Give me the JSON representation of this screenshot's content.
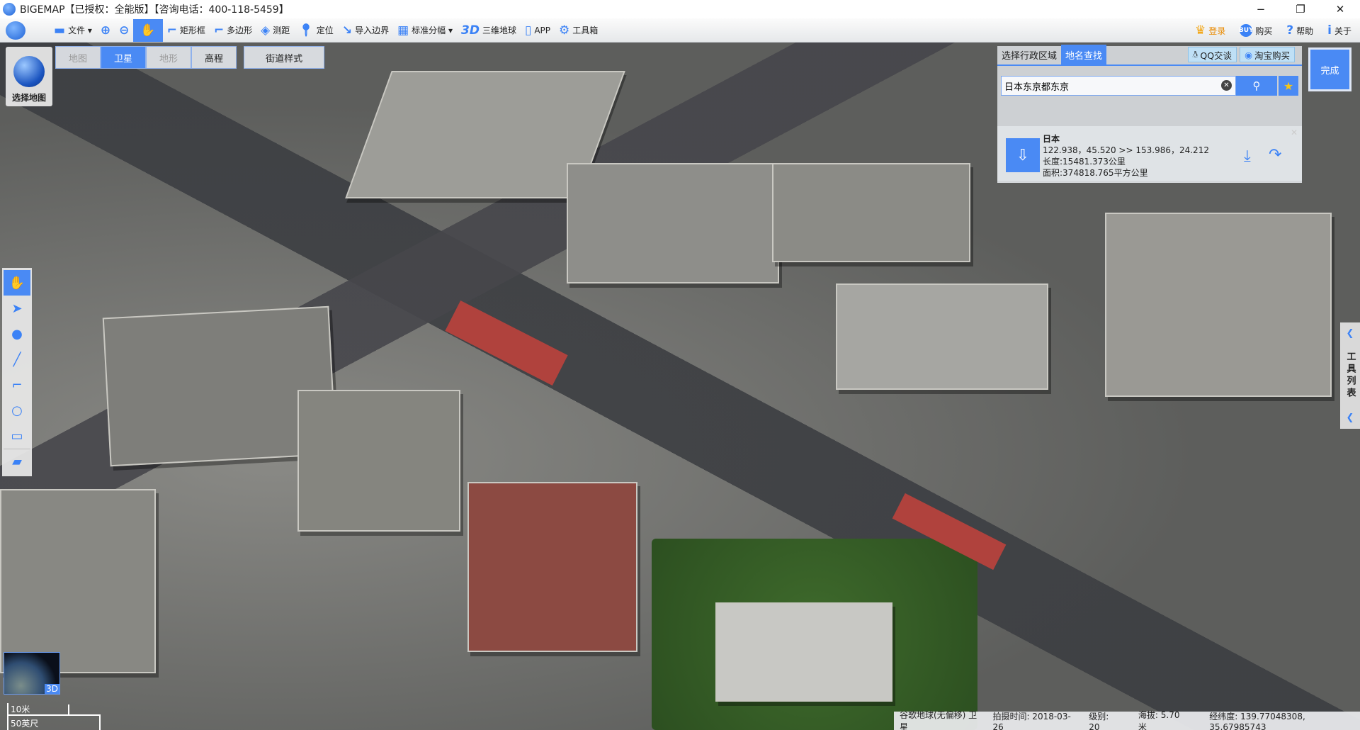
{
  "window": {
    "title": "BIGEMAP【已授权：全能版】【咨询电话：400-118-5459】",
    "minimize": "−",
    "restore": "❐",
    "close": "✕"
  },
  "toolbar": {
    "items": [
      {
        "label": "文件 ▾",
        "icon": "folder-icon"
      },
      {
        "label": "",
        "icon": "zoom-in-icon"
      },
      {
        "label": "",
        "icon": "zoom-out-icon"
      },
      {
        "label": "",
        "icon": "hand-pan-icon",
        "active": true
      },
      {
        "label": "矩形框",
        "icon": "rectangle-select-icon"
      },
      {
        "label": "多边形",
        "icon": "polygon-icon"
      },
      {
        "label": "测距",
        "icon": "ruler-icon"
      },
      {
        "label": "定位",
        "icon": "location-pin-icon"
      },
      {
        "label": "导入边界",
        "icon": "import-boundary-icon"
      },
      {
        "label": "标准分幅 ▾",
        "icon": "grid-icon"
      },
      {
        "label": "三维地球",
        "icon": "3d-icon",
        "icon_text": "3D"
      },
      {
        "label": "APP",
        "icon": "phone-icon"
      },
      {
        "label": "工具箱",
        "icon": "gear-icon"
      }
    ],
    "right": {
      "login": "登录",
      "buy": "购买",
      "help": "帮助",
      "about": "关于"
    }
  },
  "map_types": {
    "select_map": "选择地图",
    "tabs": [
      "地图",
      "卫星",
      "地形",
      "高程"
    ],
    "active": "卫星",
    "street_style": "街道样式"
  },
  "left_tools": [
    "hand-icon",
    "pointer-icon",
    "marker-icon",
    "line-icon",
    "polygon-icon",
    "circle-icon",
    "rectangle-icon",
    "ruler-icon"
  ],
  "search": {
    "tabs": [
      "选择行政区域",
      "地名查找"
    ],
    "active_tab": "地名查找",
    "qq": "QQ交谈",
    "taobao": "淘宝购买",
    "query": "日本东京都东京",
    "done": "完成"
  },
  "result": {
    "name": "日本",
    "coords": "122.938，45.520 >> 153.986，24.212",
    "length": "长度:15481.373公里",
    "area": "面积:374818.765平方公里"
  },
  "right_panel": {
    "label": "工具列表"
  },
  "status": {
    "source": "谷歌地球(无偏移) 卫星",
    "date": "拍摄时间: 2018-03-26",
    "level": "级别:  20",
    "altitude": "海拔: 5.70米",
    "coords": "经纬度:  139.77048308, 35.67985743"
  },
  "overview": {
    "badge": "3D"
  },
  "scale": {
    "metric": "10米",
    "imperial": "50英尺"
  },
  "colors": {
    "accent": "#4a8af4"
  }
}
